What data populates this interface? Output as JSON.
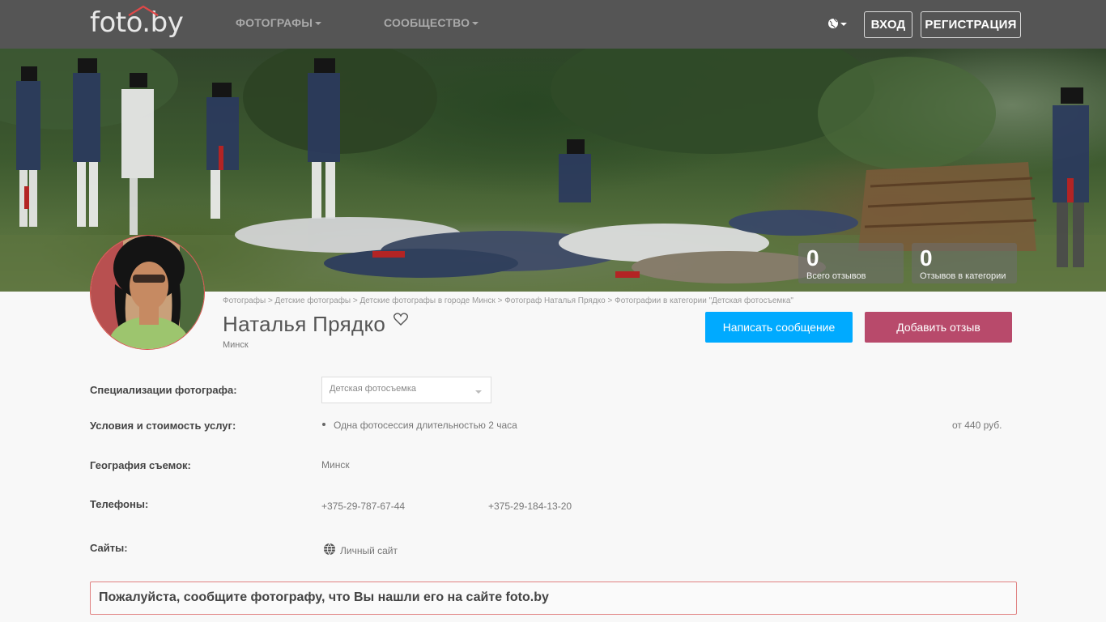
{
  "header": {
    "logo_text": "foto.by",
    "nav": [
      {
        "label": "ФОТОГРАФЫ"
      },
      {
        "label": "СООБЩЕСТВО"
      }
    ],
    "language_icon": "globe-icon",
    "login_label": "ВХОД",
    "register_label": "РЕГИСТРАЦИЯ"
  },
  "hero": {
    "stats": [
      {
        "value": "0",
        "label": "Всего отзывов"
      },
      {
        "value": "0",
        "label": "Отзывов в категории"
      }
    ]
  },
  "profile": {
    "breadcrumb": "Фотографы > Детские фотографы > Детские фотографы в городе Минск > Фотограф Наталья Прядко > Фотографии в категории \"Детская фотосъемка\"",
    "name": "Наталья Прядко",
    "city": "Минск",
    "favorite_icon": "heart-icon",
    "message_button": "Написать сообщение",
    "review_button": "Добавить отзыв"
  },
  "details": {
    "specializations_label": "Специализации фотографа:",
    "specialization_selected": "Детская фотосъемка",
    "services_label": "Условия и стоимость услуг:",
    "service_item": "Одна фотосессия длительностью 2 часа",
    "service_price": "от 440 руб.",
    "geography_label": "География съемок:",
    "geography_value": "Минск",
    "phones_label": "Телефоны:",
    "phones": [
      "+375-29-787-67-44",
      "+375-29-184-13-20"
    ],
    "sites_label": "Сайты:",
    "site_link": "Личный сайт"
  },
  "notice": "Пожалуйста, сообщите фотографу, что Вы нашли его на сайте foto.by",
  "colors": {
    "nav_bg": "#555555",
    "primary_button": "#00aaff",
    "review_button": "#b84a6b",
    "logo_accent": "#e04848",
    "notice_border": "#e08080"
  }
}
